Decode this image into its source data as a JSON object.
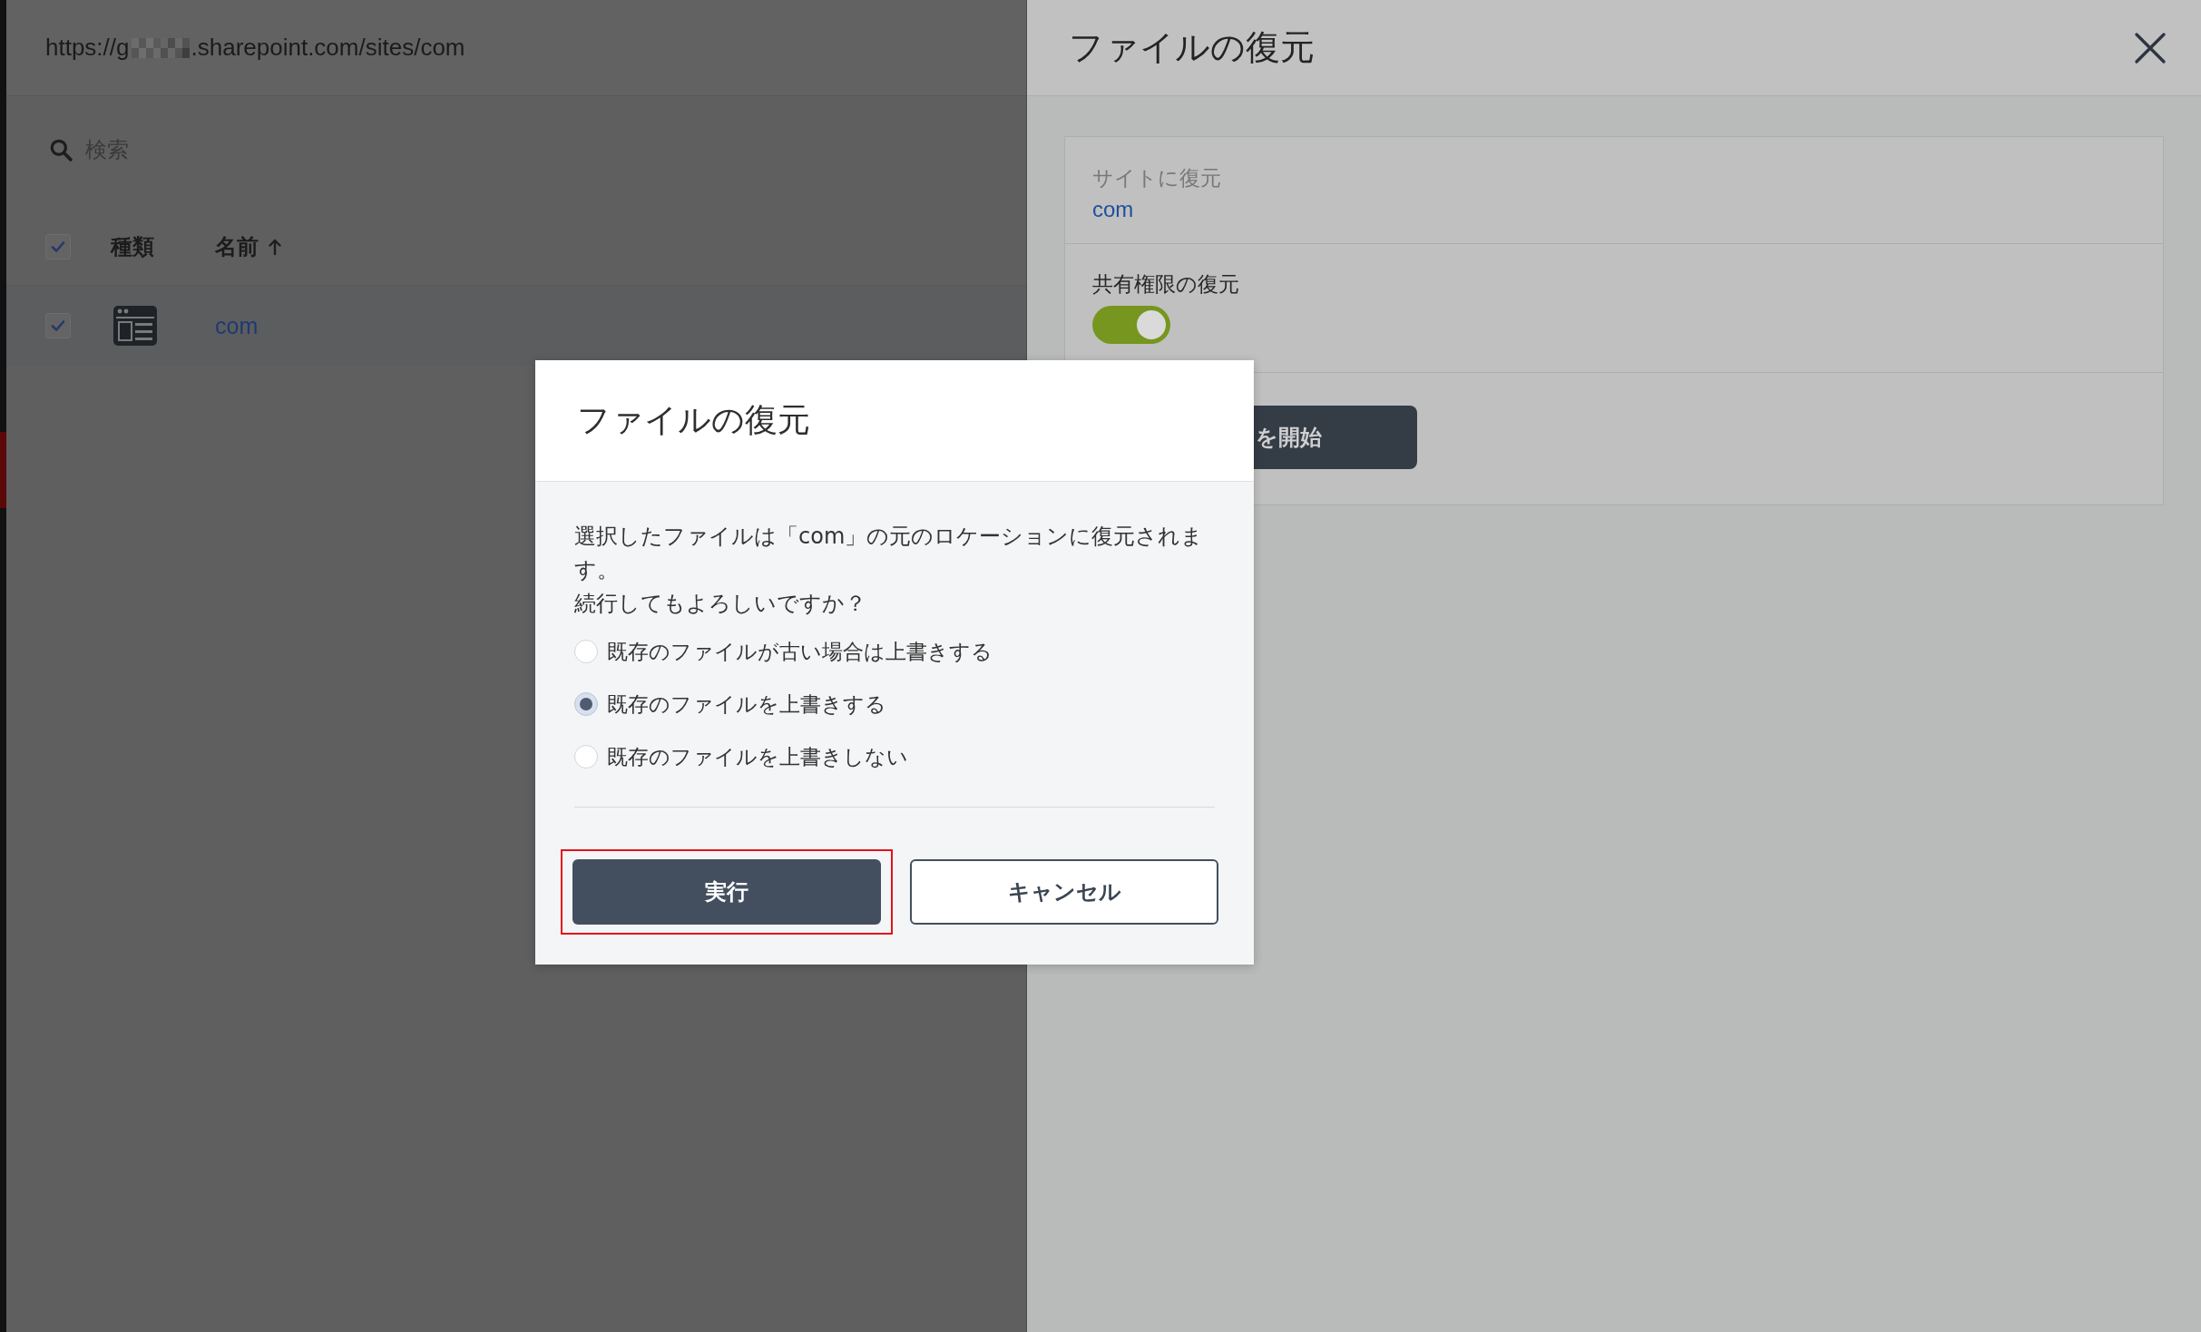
{
  "browser_panel": {
    "address": {
      "visible_start": "https://g",
      "redacted": true,
      "visible_end": ".sharepoint.com/sites/com"
    },
    "search": {
      "placeholder": "検索"
    },
    "table": {
      "select_all_checked": true,
      "columns": [
        {
          "label": "種類",
          "sorted": false
        },
        {
          "label": "名前",
          "sorted": true
        }
      ],
      "rows": [
        {
          "checked": true,
          "kind": "site",
          "name": "com"
        }
      ]
    }
  },
  "restore_panel": {
    "title": "ファイルの復元",
    "destination": {
      "label": "サイトに復元",
      "value": "com"
    },
    "permissions": {
      "label": "共有権限の復元",
      "on": true
    },
    "start_button": {
      "label": "を開始"
    }
  },
  "dialog": {
    "title": "ファイルの復元",
    "message": "選択したファイルは「com」の元のロケーションに復元されます。",
    "question": "続行してもよろしいですか？",
    "options": [
      {
        "label": "既存のファイルが古い場合は上書きする",
        "selected": false
      },
      {
        "label": "既存のファイルを上書きする",
        "selected": true
      },
      {
        "label": "既存のファイルを上書きしない",
        "selected": false
      }
    ],
    "buttons": [
      {
        "label": "実行",
        "kind": "primary",
        "highlighted": true
      },
      {
        "label": "キャンセル",
        "kind": "secondary",
        "highlighted": false
      }
    ]
  }
}
